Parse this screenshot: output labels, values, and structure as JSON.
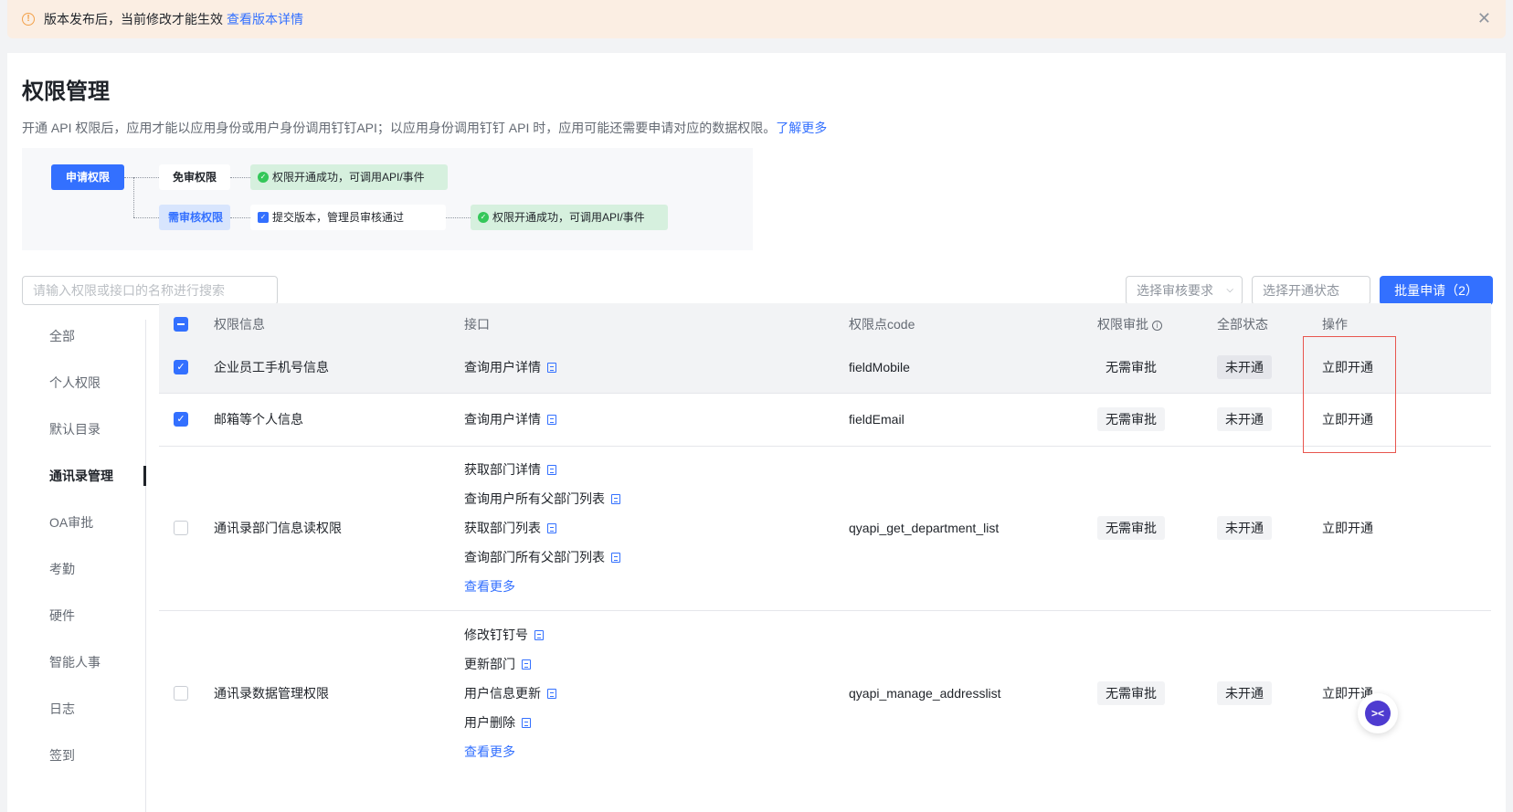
{
  "banner": {
    "message": "版本发布后，当前修改才能生效",
    "link": "查看版本详情",
    "icon": "warning-icon",
    "close_icon": "close-icon"
  },
  "page": {
    "title": "权限管理",
    "description": "开通 API 权限后，应用才能以应用身份或用户身份调用钉钉API；以应用身份调用钉钉 API 时，应用可能还需要申请对应的数据权限。",
    "learn_more": "了解更多"
  },
  "flow": {
    "apply": "申请权限",
    "free": "免审权限",
    "need_review": "需审核权限",
    "success": "权限开通成功，可调用API/事件",
    "submit": "提交版本，管理员审核通过",
    "success2": "权限开通成功，可调用API/事件"
  },
  "toolbar": {
    "search_placeholder": "请输入权限或接口的名称进行搜索",
    "review_select": "选择审核要求",
    "status_select": "选择开通状态",
    "batch_button": "批量申请（2）"
  },
  "sidebar": {
    "items": [
      {
        "label": "全部"
      },
      {
        "label": "个人权限"
      },
      {
        "label": "默认目录"
      },
      {
        "label": "通讯录管理"
      },
      {
        "label": "OA审批"
      },
      {
        "label": "考勤"
      },
      {
        "label": "硬件"
      },
      {
        "label": "智能人事"
      },
      {
        "label": "日志"
      },
      {
        "label": "签到"
      }
    ],
    "active_index": 3
  },
  "table": {
    "headers": {
      "info": "权限信息",
      "api": "接口",
      "code": "权限点code",
      "approval": "权限审批",
      "status": "全部状态",
      "action": "操作"
    },
    "rows": [
      {
        "name": "企业员工手机号信息",
        "apis": [
          "查询用户详情"
        ],
        "code": "fieldMobile",
        "approval": "无需审批",
        "status": "未开通",
        "action": "立即开通",
        "checked": true
      },
      {
        "name": "邮箱等个人信息",
        "apis": [
          "查询用户详情"
        ],
        "code": "fieldEmail",
        "approval": "无需审批",
        "status": "未开通",
        "action": "立即开通",
        "checked": true
      },
      {
        "name": "通讯录部门信息读权限",
        "apis": [
          "获取部门详情",
          "查询用户所有父部门列表",
          "获取部门列表",
          "查询部门所有父部门列表"
        ],
        "see_more": "查看更多",
        "code": "qyapi_get_department_list",
        "approval": "无需审批",
        "status": "未开通",
        "action": "立即开通",
        "checked": false
      },
      {
        "name": "通讯录数据管理权限",
        "apis": [
          "修改钉钉号",
          "更新部门",
          "用户信息更新",
          "用户删除"
        ],
        "see_more": "查看更多",
        "code": "qyapi_manage_addresslist",
        "approval": "无需审批",
        "status": "未开通",
        "action": "立即开通",
        "checked": false
      }
    ]
  },
  "colors": {
    "accent": "#3370ff",
    "banner_bg": "#fbeee3",
    "success_bg": "#d6f0de",
    "highlight_border": "#e8554e"
  },
  "float_button_icon": "chat-assistant-icon"
}
